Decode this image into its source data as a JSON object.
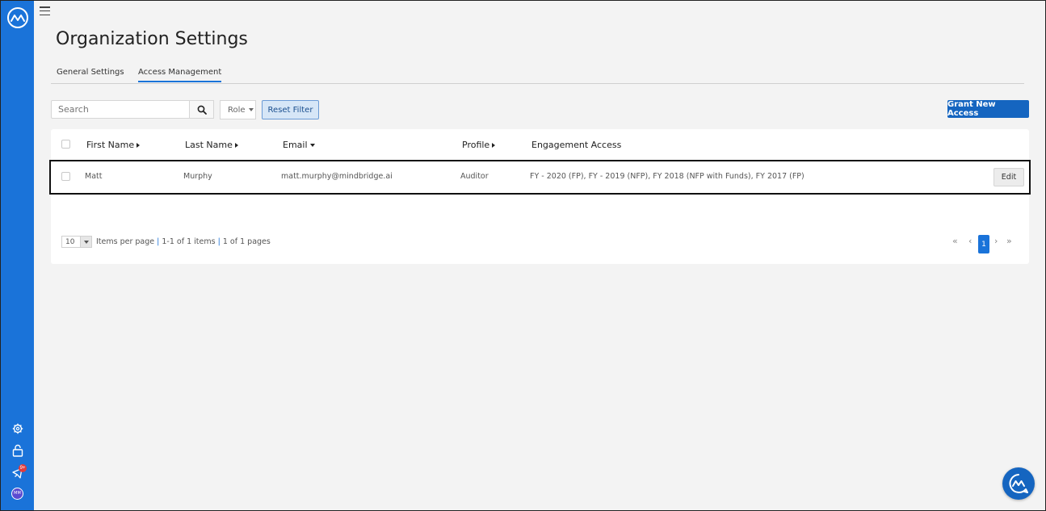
{
  "page": {
    "title": "Organization Settings"
  },
  "tabs": [
    {
      "label": "General Settings",
      "active": false
    },
    {
      "label": "Access Management",
      "active": true
    }
  ],
  "toolbar": {
    "search_placeholder": "Search",
    "role_label": "Role",
    "reset_label": "Reset Filter",
    "grant_label": "Grant New Access"
  },
  "table": {
    "columns": [
      "First Name",
      "Last Name",
      "Email",
      "Profile",
      "Engagement Access"
    ],
    "rows": [
      {
        "first_name": "Matt",
        "last_name": "Murphy",
        "email": "matt.murphy@mindbridge.ai",
        "profile": "Auditor",
        "engagement_access": "FY - 2020 (FP), FY - 2019 (NFP), FY 2018 (NFP with Funds), FY 2017 (FP)",
        "action_label": "Edit"
      }
    ]
  },
  "pager": {
    "page_size": "10",
    "items_per_page": "Items per page",
    "sep": "|",
    "range": "1-1 of 1 items",
    "pages": "1 of 1 pages",
    "current_page": "1"
  },
  "sidebar": {
    "badge": "9+",
    "avatar_initials": "MM"
  },
  "colors": {
    "sidebar": "#1a73d9",
    "primary_button": "#1565c0",
    "active_tab_underline": "#1a73d9"
  },
  "icons": [
    "logo-icon",
    "settings-icon",
    "lock-icon",
    "announcement-icon",
    "avatar",
    "menu-icon",
    "search-icon",
    "chat-icon"
  ]
}
